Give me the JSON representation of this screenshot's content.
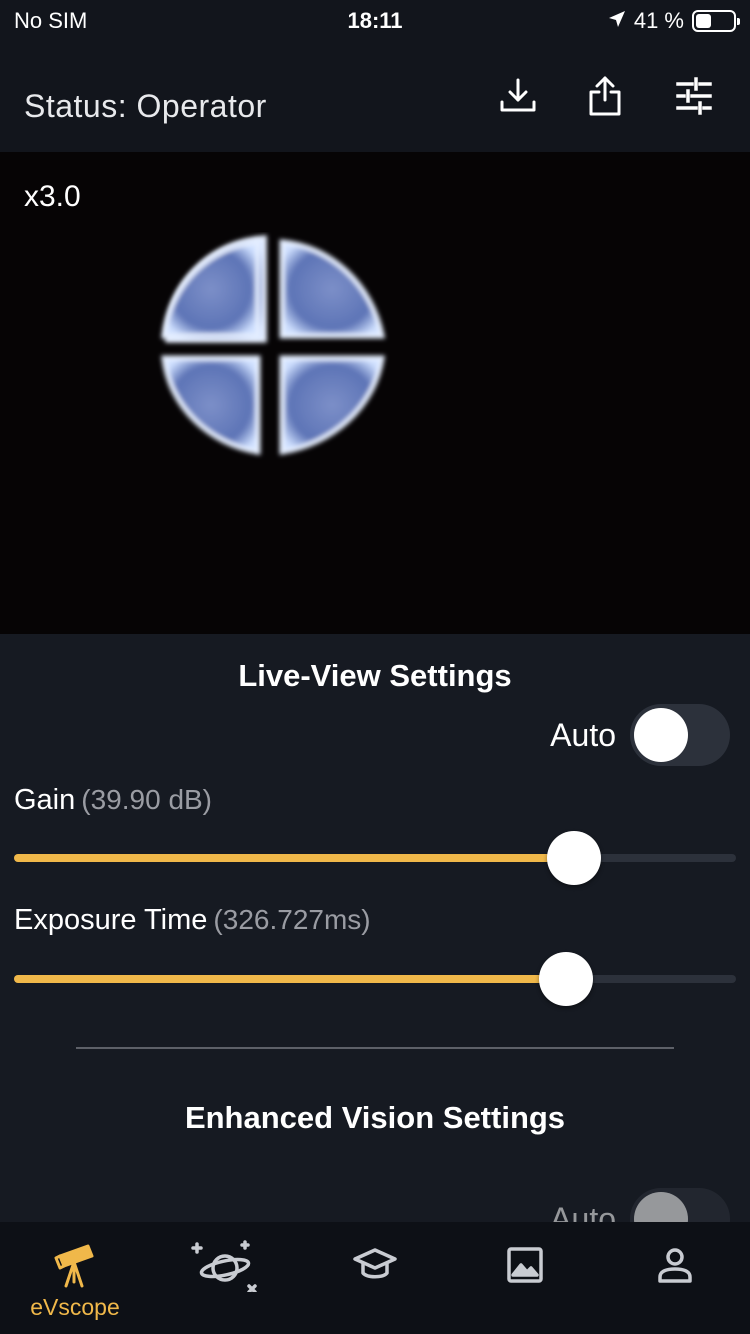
{
  "status_bar": {
    "carrier": "No SIM",
    "time": "18:11",
    "battery_percent": "41 %",
    "battery_level": 0.41
  },
  "header": {
    "title": "Status: Operator",
    "icons": [
      "download-icon",
      "share-icon",
      "sliders-icon"
    ]
  },
  "live_view": {
    "zoom": "x3.0"
  },
  "live_view_settings": {
    "title": "Live-View Settings",
    "auto_label": "Auto",
    "auto_enabled": false,
    "gain": {
      "label": "Gain",
      "value_text": "(39.90 dB)",
      "fraction": 0.775
    },
    "exposure": {
      "label": "Exposure Time",
      "value_text": "(326.727ms)",
      "fraction": 0.765
    }
  },
  "enhanced_vision_settings": {
    "title": "Enhanced Vision Settings",
    "auto_label": "Auto",
    "auto_enabled": false
  },
  "tab_bar": {
    "tabs": [
      {
        "icon": "telescope-icon",
        "label": "eVscope",
        "active": true
      },
      {
        "icon": "planet-icon",
        "label": "",
        "active": false
      },
      {
        "icon": "graduation-cap-icon",
        "label": "",
        "active": false
      },
      {
        "icon": "image-icon",
        "label": "",
        "active": false
      },
      {
        "icon": "user-icon",
        "label": "",
        "active": false
      }
    ]
  },
  "colors": {
    "accent": "#f0b84a",
    "background": "#12151c",
    "panel": "#161a22",
    "track": "#2c313b"
  }
}
